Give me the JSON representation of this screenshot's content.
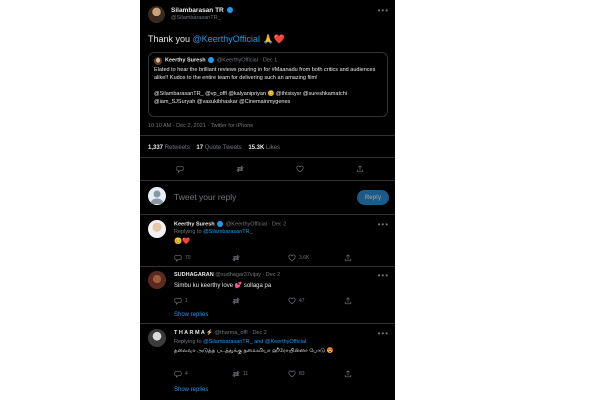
{
  "main_tweet": {
    "author_name": "Silambarasan TR",
    "author_handle": "@SilambarasanTR_",
    "text": "Thank you",
    "mention": "@KeerthyOfficial",
    "emojis": "🙏❤️",
    "quoted": {
      "author_name": "Keerthy Suresh",
      "author_handle": "@KeerthyOfficial",
      "date": "· Dec 1",
      "text": "Elated to hear the brilliant reviews pouring in for #Maanadu from both critics and audiences alike!! Kudos to the entire team for delivering such an amazing film!",
      "tags": "@SilambarasanTR_ @vp_offl @kalyanipriyan 😊 @thisisysr @sureshkamatchi @iam_SJSuryah @vasukibhaskar @Cinemainmygenes"
    },
    "meta": "10:10 AM · Dec 2, 2021 · Twitter for iPhone"
  },
  "stats": {
    "retweets_count": "1,337",
    "retweets_label": "Retweets",
    "quotes_count": "17",
    "quotes_label": "Quote Tweets",
    "likes_count": "15.3K",
    "likes_label": "Likes"
  },
  "compose": {
    "placeholder": "Tweet your reply",
    "button": "Reply"
  },
  "replies": [
    {
      "name": "Keerthy Suresh",
      "handle": "@KeerthyOfficial · Dec 2",
      "replying_prefix": "Replying to",
      "replying_to": "@SilambarasanTR_",
      "text": "😊❤️",
      "reply_count": "70",
      "retweet_count": "",
      "like_count": "3.6K"
    },
    {
      "name": "SUDHAGARAN",
      "handle": "@sudhagar37vijay · Dec 2",
      "text": "Simbu ku keerthy love 💕 sollaga pa",
      "reply_count": "1",
      "retweet_count": "",
      "like_count": "47",
      "show_replies": "Show replies"
    },
    {
      "name": "T H A R M A ⚡",
      "handle": "@tharma_offl · Dec 2",
      "replying_prefix": "Replying to",
      "replying_to": "@SilambarasanTR_ and @KeerthyOfficial",
      "text": "தலைவா அடுத்த படத்துக்கு தலைவியா ஹீரோயின்னா போடு 😍",
      "reply_count": "4",
      "retweet_count": "11",
      "like_count": "83",
      "show_replies": "Show replies"
    }
  ],
  "colors": {
    "background": "#000000",
    "accent": "#1d9bf0",
    "like": "#f91880",
    "muted": "#71767b"
  }
}
